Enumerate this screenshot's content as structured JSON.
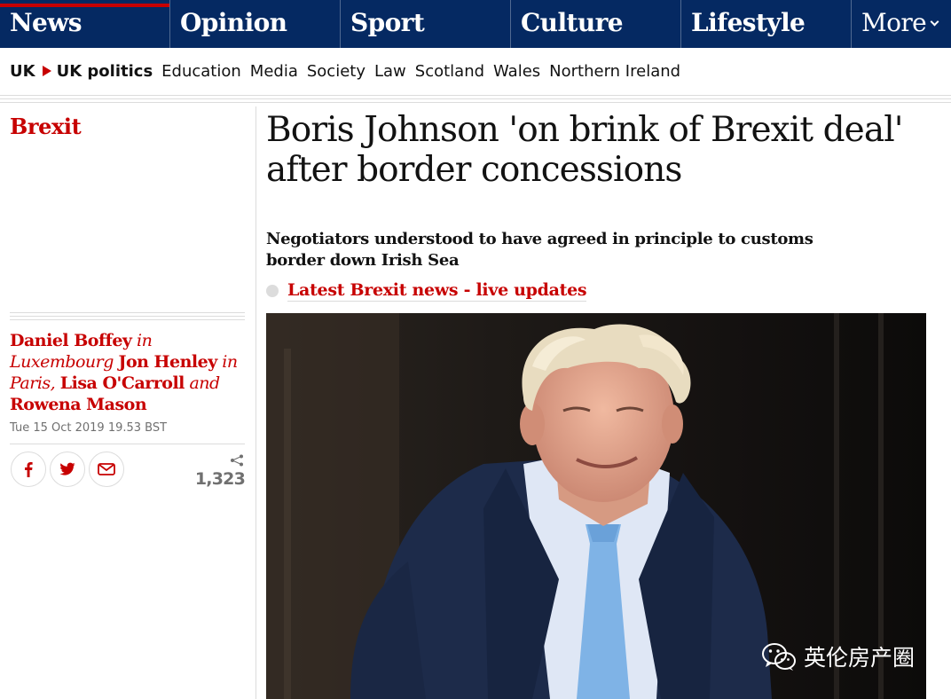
{
  "nav": {
    "pillars": [
      "News",
      "Opinion",
      "Sport",
      "Culture",
      "Lifestyle"
    ],
    "more_label": "More"
  },
  "subnav": {
    "crumb_1": "UK",
    "crumb_2": "UK politics",
    "links": [
      "Education",
      "Media",
      "Society",
      "Law",
      "Scotland",
      "Wales",
      "Northern Ireland"
    ]
  },
  "article": {
    "section": "Brexit",
    "headline": "Boris Johnson 'on brink of Brexit deal' after border concessions",
    "standfirst": "Negotiators understood to have agreed in principle to customs border down Irish Sea",
    "live_link": "Latest Brexit news - live updates",
    "byline": {
      "author_1": "Daniel Boffey",
      "in_1": " in ",
      "loc_1": "Luxembourg",
      "author_2": "Jon Henley",
      "in_2": " in ",
      "loc_2": "Paris,",
      "author_3": "Lisa O'Carroll",
      "and": " and ",
      "author_4": "Rowena Mason"
    },
    "dateline": "Tue 15 Oct 2019 19.53 BST",
    "share_count": "1,323"
  },
  "watermark": {
    "text": "英伦房产圈"
  },
  "colors": {
    "nav_bg": "#052962",
    "accent": "#c70000"
  },
  "icons": [
    "facebook-icon",
    "twitter-icon",
    "email-icon",
    "share-icon",
    "wechat-icon"
  ]
}
